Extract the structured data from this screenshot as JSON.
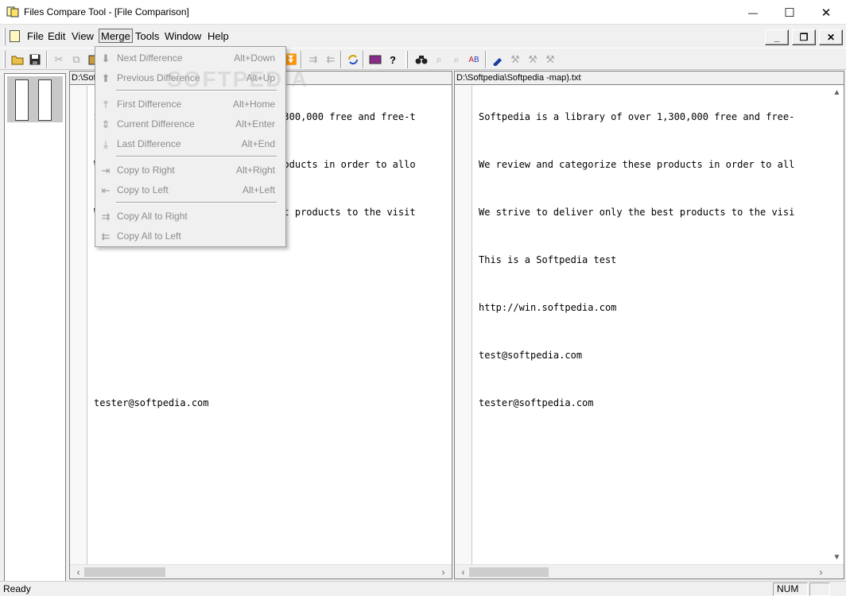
{
  "window": {
    "title": "Files Compare Tool - [File Comparison]",
    "minimize_symbol": "—",
    "maximize_symbol": "☐",
    "close_symbol": "✕"
  },
  "menubar": {
    "items": [
      {
        "label": "File"
      },
      {
        "label": "Edit"
      },
      {
        "label": "View"
      },
      {
        "label": "Merge"
      },
      {
        "label": "Tools"
      },
      {
        "label": "Window"
      },
      {
        "label": "Help"
      }
    ],
    "mdi": {
      "minimize": "_",
      "restore": "❐",
      "close": "✕"
    }
  },
  "toolbar": {
    "icons": [
      "open-folder-icon",
      "save-icon",
      "cut-icon",
      "copy-icon",
      "paste-icon",
      "next-diff-icon",
      "prev-diff-icon",
      "first-diff-icon",
      "current-diff-icon",
      "last-diff-icon",
      "copy-right-icon",
      "copy-left-icon",
      "copy-all-right-icon",
      "copy-all-left-icon",
      "refresh-icon",
      "help-book-icon",
      "help-question-icon",
      "find-icon",
      "find-next-icon",
      "replace-icon",
      "spell-icon",
      "bookmark-icon",
      "bookmark-next-icon",
      "bookmark-prev-icon",
      "bookmark-clear-icon"
    ]
  },
  "merge_menu": {
    "items": [
      {
        "label": "Next Difference",
        "shortcut": "Alt+Down",
        "icon": "arrow-down-icon"
      },
      {
        "label": "Previous Difference",
        "shortcut": "Alt+Up",
        "icon": "arrow-up-icon"
      },
      {
        "label": "First Difference",
        "shortcut": "Alt+Home",
        "icon": "arrow-first-icon"
      },
      {
        "label": "Current Difference",
        "shortcut": "Alt+Enter",
        "icon": "current-diff-icon"
      },
      {
        "label": "Last Difference",
        "shortcut": "Alt+End",
        "icon": "arrow-last-icon"
      },
      {
        "label": "Copy to Right",
        "shortcut": "Alt+Right",
        "icon": "copy-right-icon"
      },
      {
        "label": "Copy to Left",
        "shortcut": "Alt+Left",
        "icon": "copy-left-icon"
      },
      {
        "label": "Copy All to Right",
        "shortcut": "",
        "icon": "copy-all-right-icon"
      },
      {
        "label": "Copy All to Left",
        "shortcut": "",
        "icon": "copy-all-left-icon"
      }
    ]
  },
  "left_pane": {
    "path": "D:\\Softpedia\\Softpedia.txt",
    "lines": [
      "Softpedia is a library of over 1,300,000 free and free-t",
      "We review and categorize these products in order to allo",
      "We strive to deliver only the best products to the visit",
      "",
      "",
      "",
      "tester@softpedia.com"
    ]
  },
  "right_pane": {
    "path": "D:\\Softpedia\\Softpedia -map).txt",
    "lines": [
      "Softpedia is a library of over 1,300,000 free and free-",
      "We review and categorize these products in order to all",
      "We strive to deliver only the best products to the visi",
      "This is a Softpedia test",
      "http://win.softpedia.com",
      "test@softpedia.com",
      "tester@softpedia.com"
    ]
  },
  "statusbar": {
    "status": "Ready",
    "num": "NUM"
  },
  "watermark": "SOFTPEDIA"
}
